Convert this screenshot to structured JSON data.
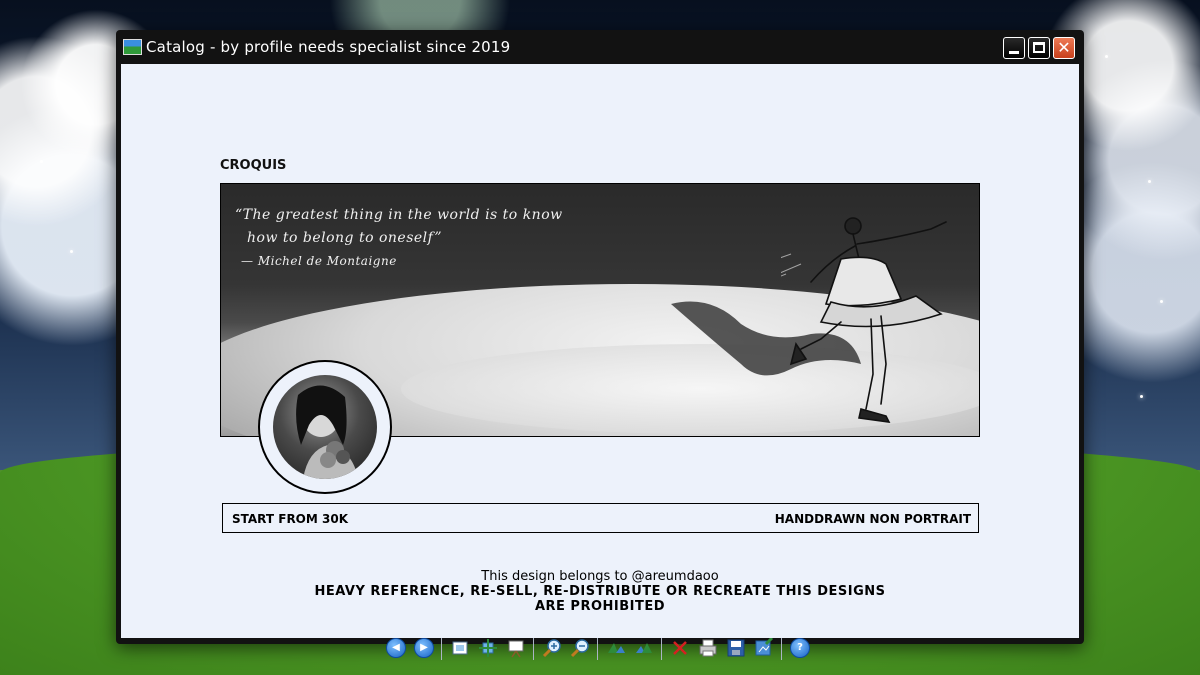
{
  "window": {
    "title": "Catalog - by profile needs specialist since 2019",
    "controls": {
      "minimize": "minimize",
      "maximize": "maximize",
      "close": "close"
    }
  },
  "content": {
    "section_title": "CROQUIS",
    "banner": {
      "quote_line1": "“The greatest thing in the world is to know",
      "quote_line2": "how to belong to oneself”",
      "quote_author": "— Michel de Montaigne"
    },
    "price_left": "START FROM 30K",
    "price_right": "HANDDRAWN NON PORTRAIT",
    "credit_line1": "This design belongs to @areumdaoo",
    "credit_line2": "HEAVY REFERENCE, RE-SELL, RE-DISTRIBUTE OR RECREATE THIS DESIGNS",
    "credit_line3": "ARE PROHIBITED"
  },
  "toolbar": {
    "icons": [
      "previous-icon",
      "next-icon",
      "actual-size-icon",
      "best-fit-icon",
      "slideshow-icon",
      "zoom-in-icon",
      "zoom-out-icon",
      "rotate-clockwise-icon",
      "rotate-counterclockwise-icon",
      "delete-icon",
      "print-icon",
      "save-icon",
      "edit-icon",
      "help-icon"
    ]
  },
  "colors": {
    "client_bg": "#edf2fb",
    "title_bar": "#121212",
    "close_button": "#d9532d"
  }
}
